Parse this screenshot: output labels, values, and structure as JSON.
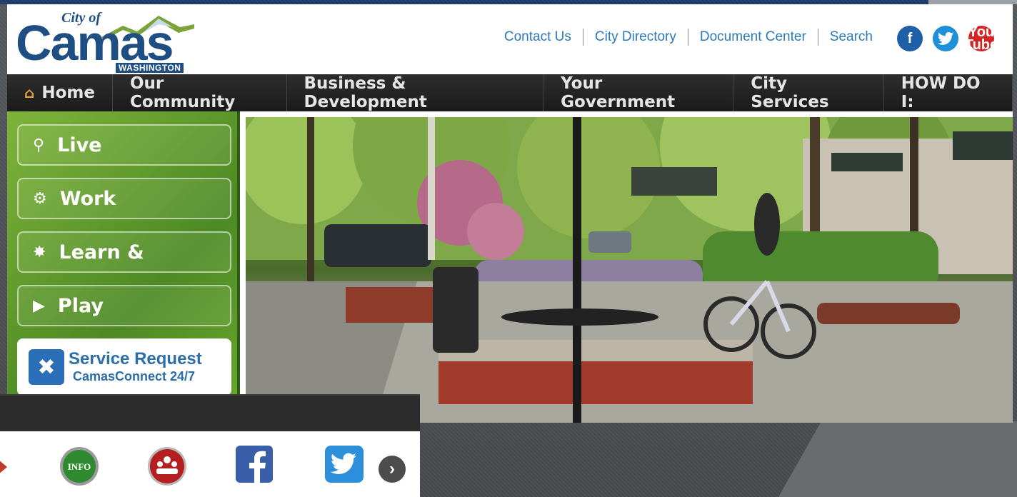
{
  "header": {
    "logo": {
      "city_of": "City of",
      "name": "Camas",
      "state": "WASHINGTON"
    },
    "utility_links": [
      "Contact Us",
      "City Directory",
      "Document Center",
      "Search"
    ],
    "social": {
      "facebook": "f",
      "twitter": "t",
      "youtube_line1": "You",
      "youtube_line2": "Tube"
    }
  },
  "nav": {
    "items": [
      "Home",
      "Our Community",
      "Business & Development",
      "Your Government",
      "City Services",
      "HOW DO I:"
    ]
  },
  "panel": {
    "buttons": [
      {
        "label": "Live",
        "icon": "location-pin-icon"
      },
      {
        "label": "Work",
        "icon": "gear-icon"
      },
      {
        "label": "Learn &",
        "icon": "lightbulb-icon"
      },
      {
        "label": "Play",
        "icon": "play-icon"
      }
    ],
    "service_request": {
      "title": "Service Request",
      "subtitle": "CamasConnect 24/7"
    }
  },
  "app_strip": {
    "icons": [
      "info-icon",
      "meeting-icon",
      "facebook-icon",
      "twitter-icon"
    ],
    "info_label": "INFO",
    "next_glyph": "›"
  },
  "colors": {
    "brand_blue": "#1f4f82",
    "link_blue": "#2a79b8",
    "nav_bg": "#1b1b1b",
    "panel_green": "#5b972a"
  }
}
